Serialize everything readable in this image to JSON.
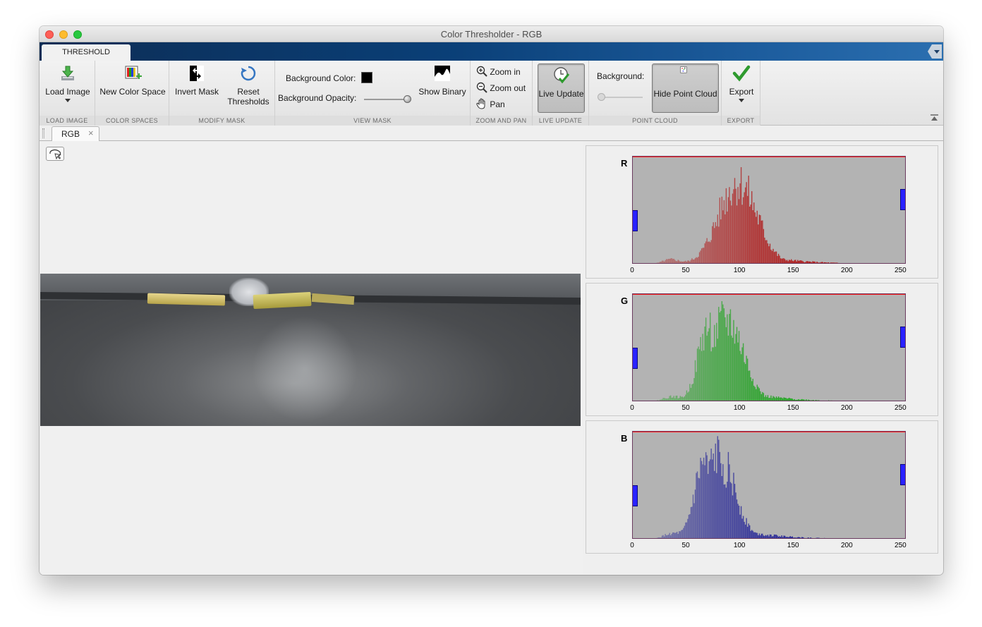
{
  "window": {
    "title": "Color Thresholder - RGB"
  },
  "ribbon": {
    "tab": "THRESHOLD",
    "load_image": {
      "label": "Load Image",
      "section": "LOAD IMAGE"
    },
    "color_spaces": {
      "label": "New Color Space",
      "section": "COLOR SPACES"
    },
    "modify_mask": {
      "invert": "Invert Mask",
      "reset_line1": "Reset",
      "reset_line2": "Thresholds",
      "section": "MODIFY MASK"
    },
    "view_mask": {
      "bg_color_label": "Background Color:",
      "bg_color_value": "#000000",
      "bg_opacity_label": "Background Opacity:",
      "bg_opacity_value": 1.0,
      "show_binary": "Show Binary",
      "section": "VIEW MASK"
    },
    "zoom_pan": {
      "zoom_in": "Zoom in",
      "zoom_out": "Zoom out",
      "pan": "Pan",
      "section": "ZOOM AND PAN"
    },
    "live_update": {
      "label": "Live Update",
      "section": "LIVE UPDATE"
    },
    "point_cloud": {
      "bg_label": "Background:",
      "hide": "Hide Point Cloud",
      "section": "POINT CLOUD"
    },
    "export": {
      "label": "Export",
      "section": "EXPORT"
    }
  },
  "document_tab": {
    "label": "RGB",
    "close": "×"
  },
  "histograms": [
    {
      "channel": "R",
      "color": "#b00000",
      "peak_at": 98,
      "spread": 18,
      "second_peak": null,
      "threshold_min": 0,
      "threshold_max": 255
    },
    {
      "channel": "G",
      "color": "#00a000",
      "peak_at": 87,
      "spread": 16,
      "second_peak": 70,
      "threshold_min": 0,
      "threshold_max": 255
    },
    {
      "channel": "B",
      "color": "#000090",
      "peak_at": 80,
      "spread": 15,
      "second_peak": 66,
      "threshold_min": 0,
      "threshold_max": 255
    }
  ],
  "axis_ticks": [
    "0",
    "50",
    "100",
    "150",
    "200",
    "250"
  ]
}
